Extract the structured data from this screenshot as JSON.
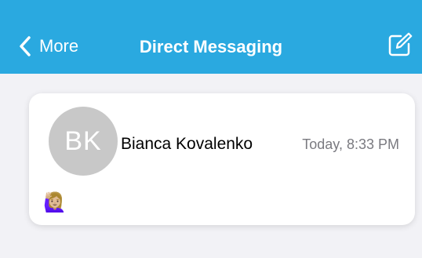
{
  "header": {
    "back_label": "More",
    "title": "Direct Messaging",
    "back_icon": "chevron-left-icon",
    "compose_icon": "compose-icon",
    "color": "#2aa9e0"
  },
  "conversations": [
    {
      "avatar_initials": "BK",
      "name": "Bianca Kovalenko",
      "timestamp": "Today, 8:33 PM",
      "preview": "🙋🏼‍♀️"
    }
  ]
}
